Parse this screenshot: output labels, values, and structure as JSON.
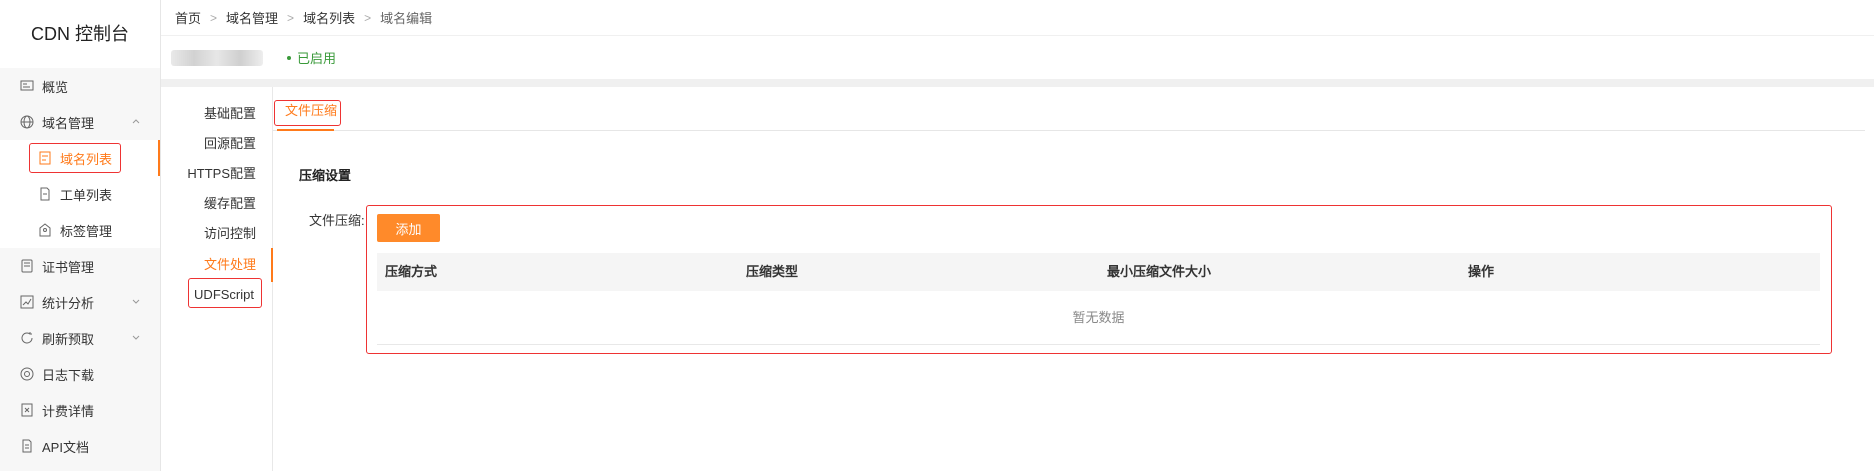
{
  "sidebar": {
    "title": "CDN 控制台",
    "items": [
      {
        "label": "概览",
        "icon": "overview-icon"
      },
      {
        "label": "域名管理",
        "icon": "www-globe-icon",
        "expanded": true,
        "children": [
          {
            "label": "域名列表",
            "icon": "domain-list-icon",
            "active": true
          },
          {
            "label": "工单列表",
            "icon": "document-icon"
          },
          {
            "label": "标签管理",
            "icon": "tag-icon"
          }
        ]
      },
      {
        "label": "证书管理",
        "icon": "certificate-icon"
      },
      {
        "label": "统计分析",
        "icon": "chart-icon",
        "has_submenu": true
      },
      {
        "label": "刷新预取",
        "icon": "refresh-icon",
        "has_submenu": true
      },
      {
        "label": "日志下载",
        "icon": "log-download-icon"
      },
      {
        "label": "计费详情",
        "icon": "billing-icon"
      },
      {
        "label": "API文档",
        "icon": "api-doc-icon"
      }
    ]
  },
  "breadcrumb": [
    "首页",
    "域名管理",
    "域名列表",
    "域名编辑"
  ],
  "domain": {
    "status": "已启用",
    "status_color": "#3a9a3a"
  },
  "config_menu": {
    "items": [
      "基础配置",
      "回源配置",
      "HTTPS配置",
      "缓存配置",
      "访问控制",
      "文件处理",
      "UDFScript"
    ],
    "active_index": 5
  },
  "tabs": [
    {
      "label": "文件压缩",
      "active": true
    }
  ],
  "section": {
    "title": "压缩设置",
    "field_label": "文件压缩:",
    "add_button": "添加",
    "columns": [
      "压缩方式",
      "压缩类型",
      "最小压缩文件大小",
      "操作"
    ],
    "empty_text": "暂无数据"
  },
  "colors": {
    "accent": "#ff7a1a",
    "button": "#ff8a2a",
    "highlight_border": "#e33333"
  }
}
